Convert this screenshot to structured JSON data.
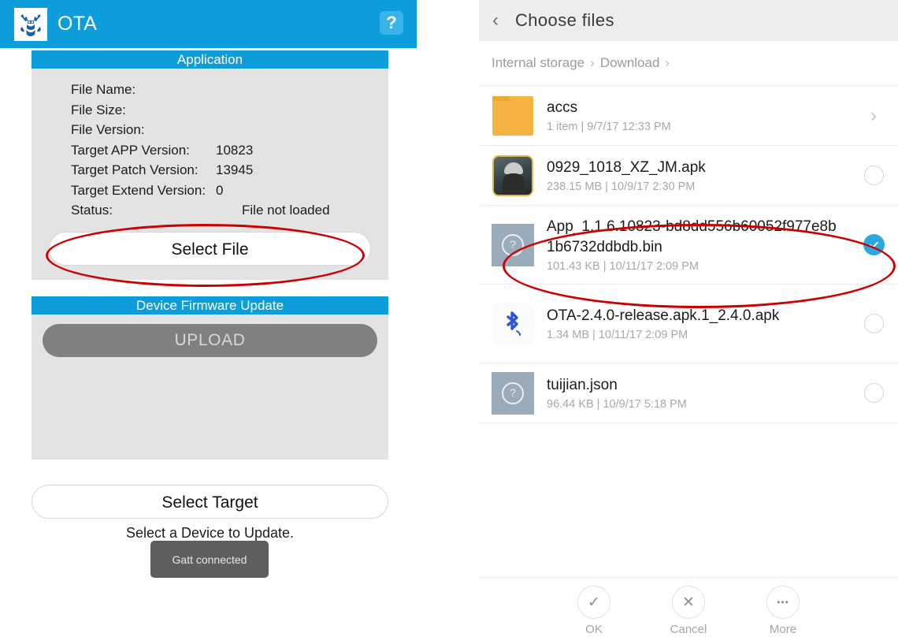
{
  "left_app": {
    "title": "OTA",
    "logo_icon": "ota-antler-logo-icon",
    "help_icon": "help-question-icon",
    "help_label": "?",
    "accent_color": "#0d9ddb",
    "application_card": {
      "header": "Application",
      "rows": [
        {
          "label": "File Name:",
          "value": ""
        },
        {
          "label": "File Size:",
          "value": ""
        },
        {
          "label": "File Version:",
          "value": ""
        },
        {
          "label": "Target APP Version:",
          "value": "10823"
        },
        {
          "label": "Target Patch Version:",
          "value": "13945"
        },
        {
          "label": "Target Extend Version:",
          "value": "0"
        },
        {
          "label": "Status:",
          "value": "File not loaded"
        }
      ],
      "select_file_label": "Select File"
    },
    "firmware_card": {
      "header": "Device Firmware Update",
      "upload_label": "UPLOAD",
      "upload_disabled_color": "#808080"
    },
    "select_target_label": "Select Target",
    "select_target_hint": "Select a Device to Update.",
    "toast_message": "Gatt connected"
  },
  "file_chooser": {
    "back_icon": "chevron-left-icon",
    "back_glyph": "‹",
    "title": "Choose  files",
    "breadcrumb": {
      "parts": [
        "Internal storage",
        "Download"
      ],
      "separator": "›"
    },
    "files": [
      {
        "name": "accs",
        "meta": "1 item  |  9/7/17 12:33 PM",
        "icon": "folder-icon",
        "trailing": "chevron",
        "selected": false
      },
      {
        "name": "0929_1018_XZ_JM.apk",
        "meta": "238.15 MB  |  10/9/17 2:30 PM",
        "icon": "apk-game-thumbnail-icon",
        "trailing": "radio",
        "selected": false
      },
      {
        "name": "App_1.1.6.10823-bd8dd556b60052f977e8b1b6732ddbdb.bin",
        "meta": "101.43 KB  |  10/11/17 2:09 PM",
        "icon": "unknown-file-icon",
        "trailing": "radio",
        "selected": true
      },
      {
        "name": "OTA-2.4.0-release.apk.1_2.4.0.apk",
        "meta": "1.34 MB  |  10/11/17 2:09 PM",
        "icon": "bluetooth-apk-icon",
        "trailing": "radio",
        "selected": false
      },
      {
        "name": "tuijian.json",
        "meta": "96.44 KB  |  10/9/17 5:18 PM",
        "icon": "unknown-file-icon",
        "trailing": "radio",
        "selected": false
      }
    ],
    "actions": [
      {
        "label": "OK",
        "icon": "check-icon",
        "glyph": "✓"
      },
      {
        "label": "Cancel",
        "icon": "close-icon",
        "glyph": "✕"
      },
      {
        "label": "More",
        "icon": "more-dots-icon",
        "glyph": "•••"
      }
    ],
    "selected_color": "#2aa8e0"
  },
  "annotations": {
    "color": "#cc0000",
    "highlights": [
      "select-file-button",
      "selected-bin-file-row"
    ]
  }
}
